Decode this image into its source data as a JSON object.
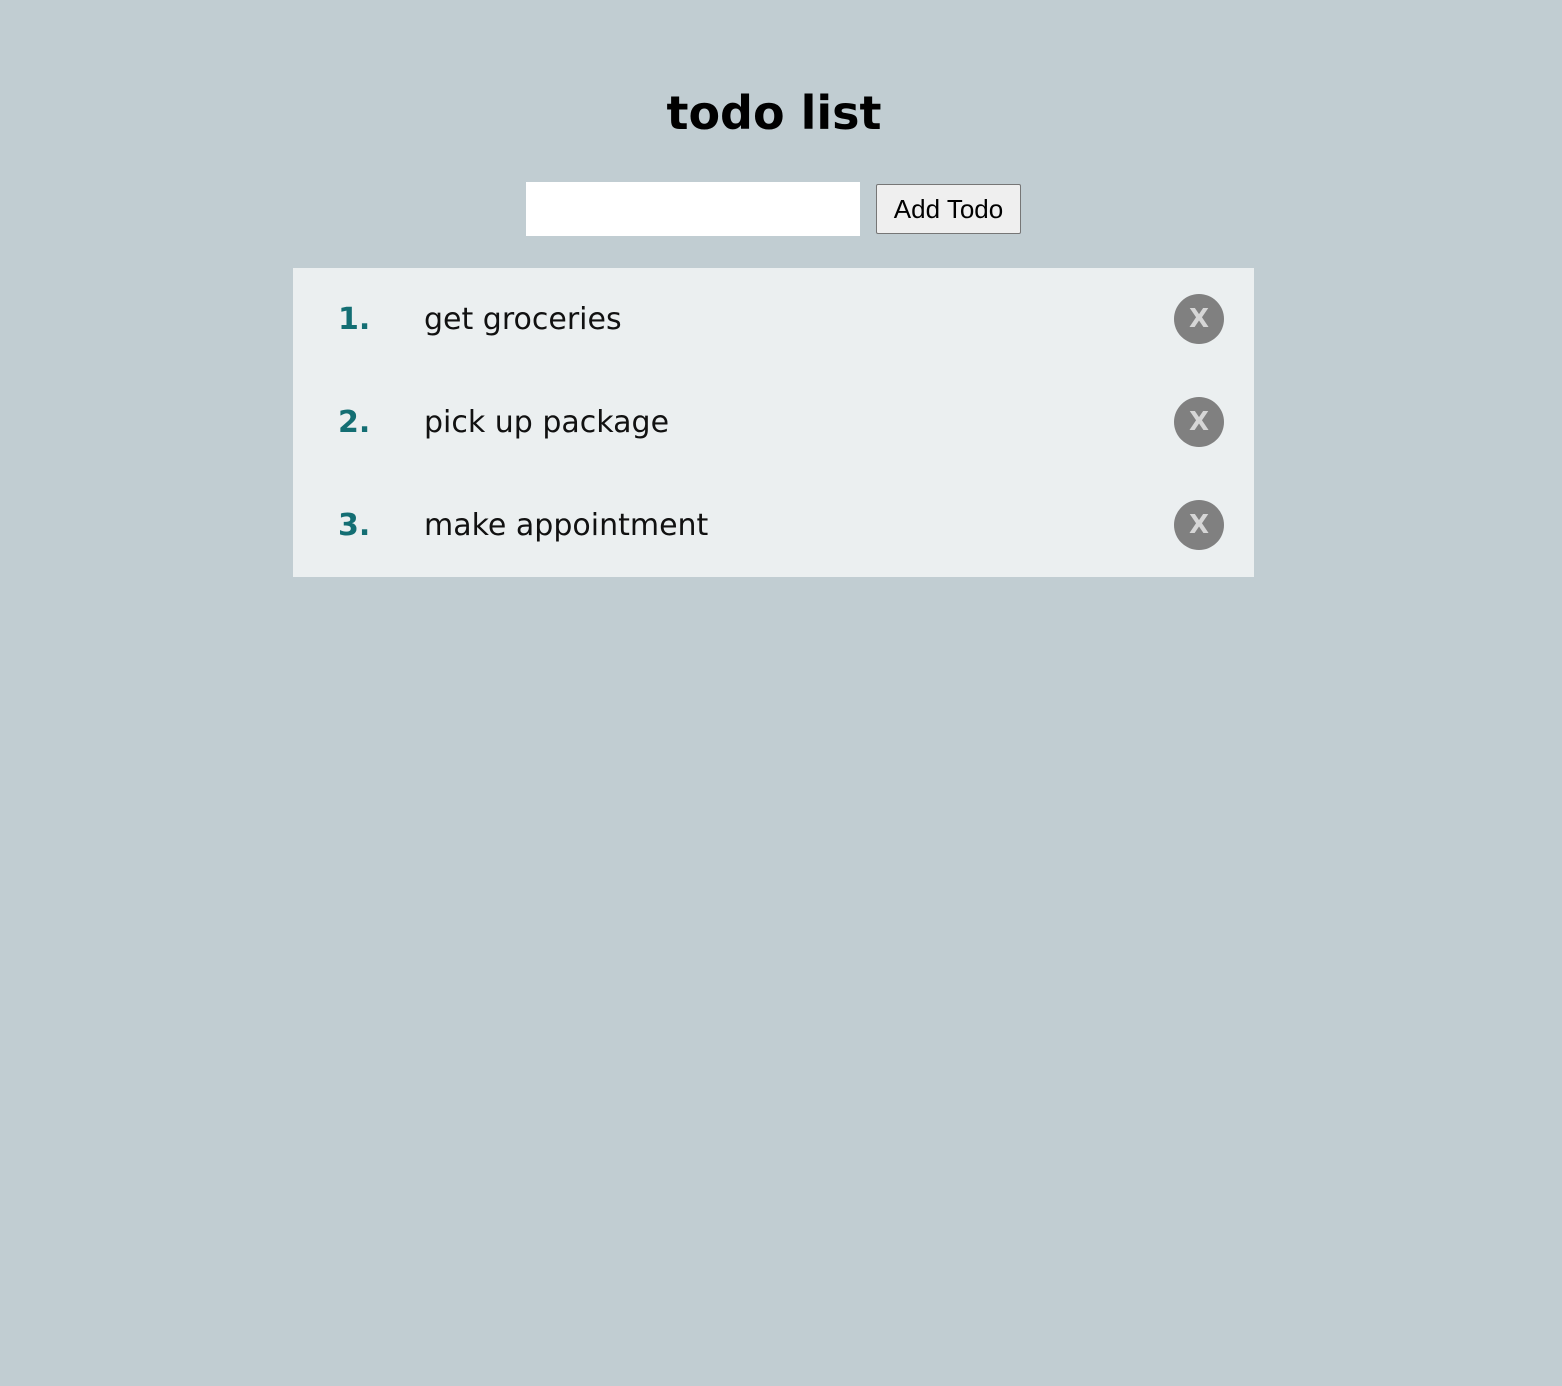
{
  "header": {
    "title": "todo list"
  },
  "form": {
    "input_value": "",
    "input_placeholder": "",
    "add_button_label": "Add Todo"
  },
  "todos": [
    {
      "number": "1.",
      "text": "get groceries",
      "delete_label": "X"
    },
    {
      "number": "2.",
      "text": "pick up package",
      "delete_label": "X"
    },
    {
      "number": "3.",
      "text": "make appointment",
      "delete_label": "X"
    }
  ],
  "colors": {
    "background": "#c1cdd2",
    "list_background": "#ebeff0",
    "number_color": "#136e73",
    "delete_button_bg": "#808080",
    "delete_button_text": "#d6d6d6"
  }
}
